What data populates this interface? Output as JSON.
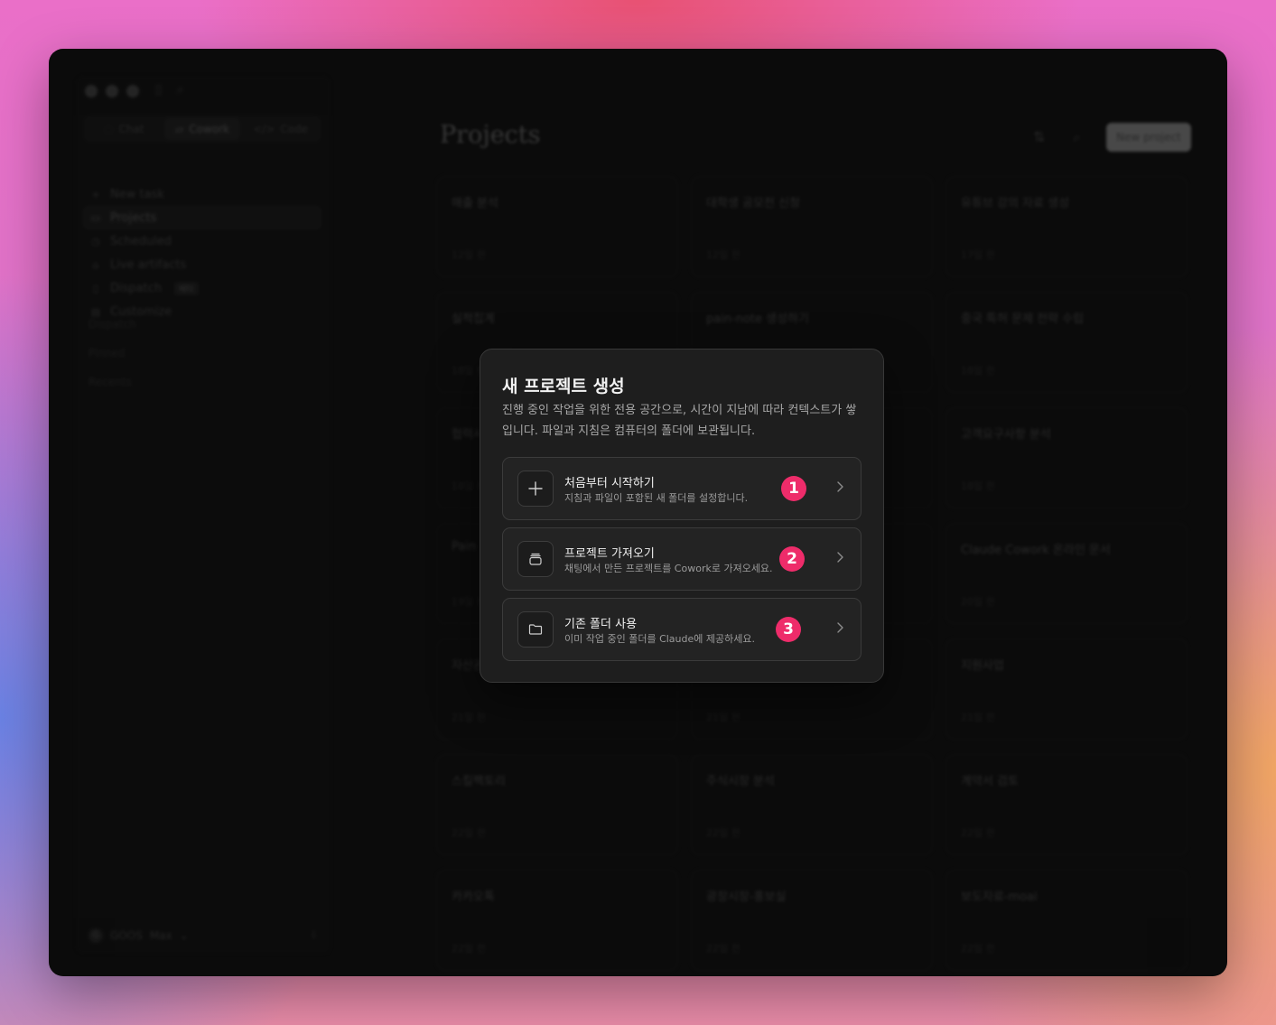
{
  "sidebar": {
    "mode_tabs": [
      {
        "label": "Chat",
        "icon": "chat-icon",
        "glyph": "◌"
      },
      {
        "label": "Cowork",
        "icon": "cowork-icon",
        "glyph": "▱"
      },
      {
        "label": "Code",
        "icon": "code-icon",
        "glyph": "</>"
      }
    ],
    "nav": [
      {
        "label": "New task",
        "icon": "plus-icon",
        "glyph": "+"
      },
      {
        "label": "Projects",
        "icon": "folder-icon",
        "glyph": "▭"
      },
      {
        "label": "Scheduled",
        "icon": "clock-icon",
        "glyph": "◷"
      },
      {
        "label": "Live artifacts",
        "icon": "artifact-icon",
        "glyph": "⌂"
      },
      {
        "label": "Dispatch",
        "icon": "phone-icon",
        "glyph": "▯",
        "badge": "베타"
      },
      {
        "label": "Customize",
        "icon": "briefcase-icon",
        "glyph": "▤"
      }
    ],
    "sections": {
      "dispatch": "Dispatch",
      "pinned": "Pinned",
      "recents": "Recents"
    },
    "user": {
      "initial": "G",
      "name": "GOOS",
      "plan": "Max"
    }
  },
  "main": {
    "title": "Projects",
    "new_project_label": "New project",
    "projects": [
      {
        "title": "매출 분석",
        "time": "12일 전"
      },
      {
        "title": "대학생 공모전 신청",
        "time": "12일 전"
      },
      {
        "title": "유튜브 강의 자료 생성",
        "time": "17일 전"
      },
      {
        "title": "실적집계",
        "time": "18일 전"
      },
      {
        "title": "pain-note 생성하기",
        "time": ""
      },
      {
        "title": "중국 특허 문제 전략 수립",
        "time": "18일 전"
      },
      {
        "title": "협력사",
        "time": "18일 전"
      },
      {
        "title": "",
        "time": ""
      },
      {
        "title": "고객요구사항 분석",
        "time": "18일 전"
      },
      {
        "title": "Pain",
        "time": "19일 전"
      },
      {
        "title": "",
        "time": ""
      },
      {
        "title": "Claude Cowork 온라인 문서",
        "time": "20일 전"
      },
      {
        "title": "자산관",
        "time": "21일 전"
      },
      {
        "title": "",
        "time": "21일 전"
      },
      {
        "title": "지원사업",
        "time": "21일 전"
      },
      {
        "title": "스킬팩토리",
        "time": "22일 전"
      },
      {
        "title": "주식시장 분석",
        "time": "22일 전"
      },
      {
        "title": "계약서 검토",
        "time": "22일 전"
      },
      {
        "title": "카카오톡",
        "time": "22일 전"
      },
      {
        "title": "광장시장-홍보실",
        "time": "22일 전"
      },
      {
        "title": "보도자료-moai",
        "time": "22일 전"
      }
    ]
  },
  "modal": {
    "title": "새 프로젝트 생성",
    "description": "진행 중인 작업을 위한 전용 공간으로, 시간이 지남에 따라 컨텍스트가 쌓입니다. 파일과 지침은 컴퓨터의 폴더에 보관됩니다.",
    "options": [
      {
        "title": "처음부터 시작하기",
        "subtitle": "지침과 파일이 포함된 새 폴더를 설정합니다.",
        "icon": "plus-icon",
        "number": "1"
      },
      {
        "title": "프로젝트 가져오기",
        "subtitle": "채팅에서 만든 프로젝트를 Cowork로 가져오세요.",
        "icon": "import-stack-icon",
        "number": "2"
      },
      {
        "title": "기존 폴더 사용",
        "subtitle": "이미 작업 중인 폴더를 Claude에 제공하세요.",
        "icon": "folder-icon",
        "number": "3"
      }
    ],
    "accent_color": "#ee2c6a"
  }
}
